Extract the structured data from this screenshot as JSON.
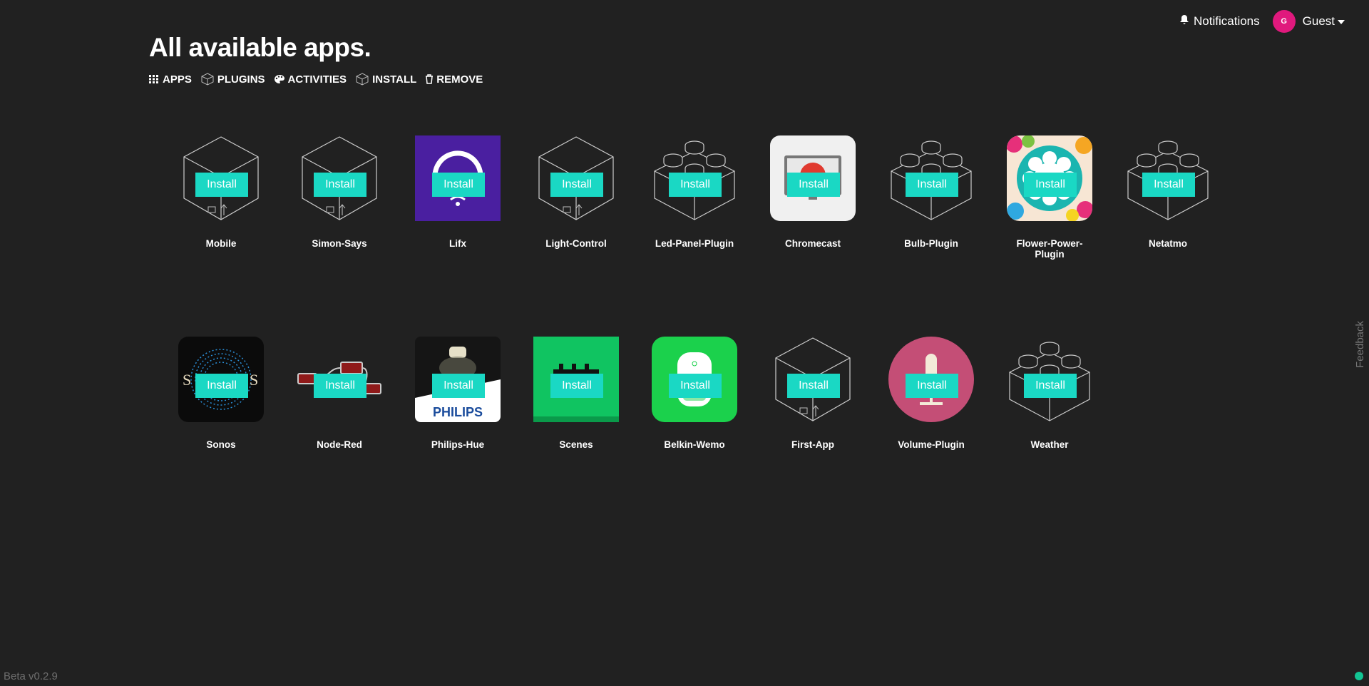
{
  "header": {
    "notifications_label": "Notifications",
    "avatar_initial": "G",
    "user_label": "Guest"
  },
  "page_title": "All available apps.",
  "nav": [
    {
      "label": "APPS",
      "icon": "grid-icon"
    },
    {
      "label": "PLUGINS",
      "icon": "cube-icon"
    },
    {
      "label": "ACTIVITIES",
      "icon": "palette-icon"
    },
    {
      "label": "INSTALL",
      "icon": "cube-icon"
    },
    {
      "label": "REMOVE",
      "icon": "trash-icon"
    }
  ],
  "install_label": "Install",
  "apps_row1": [
    {
      "name": "Mobile",
      "icon": "box-icon"
    },
    {
      "name": "Simon-Says",
      "icon": "box-icon"
    },
    {
      "name": "Lifx",
      "icon": "lifx-icon",
      "color": "#4a1fa0"
    },
    {
      "name": "Light-Control",
      "icon": "box-icon"
    },
    {
      "name": "Led-Panel-Plugin",
      "icon": "brick-icon"
    },
    {
      "name": "Chromecast",
      "icon": "chromecast-icon"
    },
    {
      "name": "Bulb-Plugin",
      "icon": "brick-icon"
    },
    {
      "name": "Flower-Power-Plugin",
      "icon": "flower-power-icon"
    },
    {
      "name": "Netatmo",
      "icon": "brick-icon"
    }
  ],
  "apps_row2": [
    {
      "name": "Sonos",
      "icon": "sonos-icon"
    },
    {
      "name": "Node-Red",
      "icon": "node-red-icon"
    },
    {
      "name": "Philips-Hue",
      "icon": "philips-hue-icon",
      "brand_text": "PHILIPS"
    },
    {
      "name": "Scenes",
      "icon": "scenes-icon",
      "color": "#10c461"
    },
    {
      "name": "Belkin-Wemo",
      "icon": "wemo-icon",
      "color": "#1bd14c"
    },
    {
      "name": "First-App",
      "icon": "box-icon"
    },
    {
      "name": "Volume-Plugin",
      "icon": "microphone-icon",
      "color": "#c44e76"
    },
    {
      "name": "Weather",
      "icon": "brick-icon"
    }
  ],
  "footer_version": "Beta v0.2.9",
  "feedback_label": "Feedback",
  "accent_color": "#1ad8c4"
}
